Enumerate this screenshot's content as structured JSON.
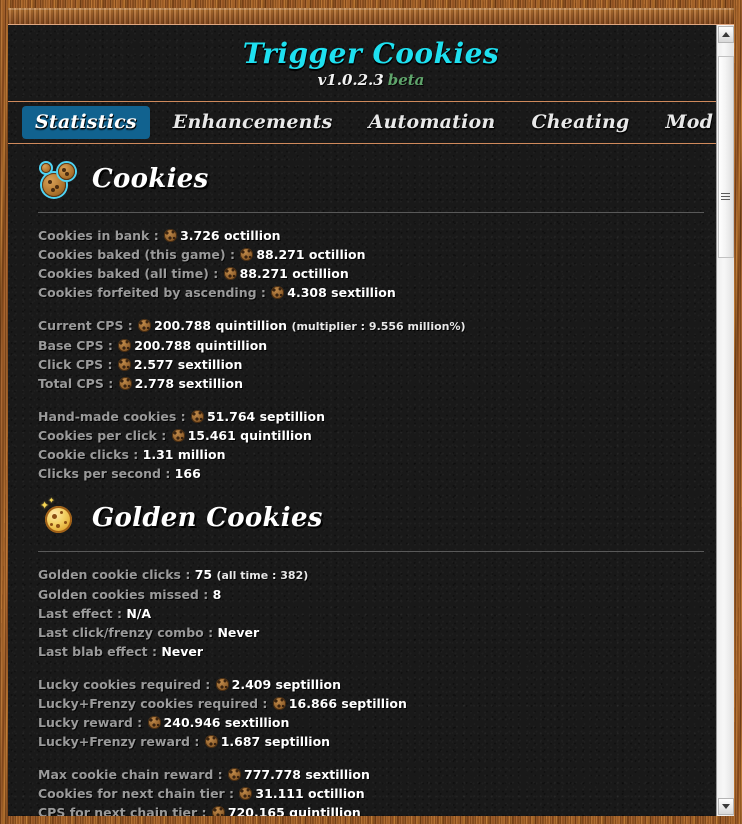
{
  "header": {
    "title": "Trigger Cookies",
    "version": "v1.0.2.3",
    "channel": "beta",
    "title_color": "#1ee0f0",
    "beta_color": "#5fa46b"
  },
  "tabs": [
    {
      "label": "Statistics",
      "active": true
    },
    {
      "label": "Enhancements",
      "active": false
    },
    {
      "label": "Automation",
      "active": false
    },
    {
      "label": "Cheating",
      "active": false
    },
    {
      "label": "Mod List",
      "active": false
    }
  ],
  "sections": [
    {
      "id": "cookies",
      "title": "Cookies",
      "icon": "cookie-stack-icon",
      "groups": [
        {
          "rows": [
            {
              "label": "Cookies in bank :",
              "cookie": true,
              "value": "3.726 octillion"
            },
            {
              "label": "Cookies baked (this game) :",
              "cookie": true,
              "value": "88.271 octillion"
            },
            {
              "label": "Cookies baked (all time) :",
              "cookie": true,
              "value": "88.271 octillion"
            },
            {
              "label": "Cookies forfeited by ascending :",
              "cookie": true,
              "value": "4.308 sextillion"
            }
          ]
        },
        {
          "rows": [
            {
              "label": "Current CPS :",
              "cookie": true,
              "value": "200.788 quintillion",
              "note": "(multiplier : 9.556 million%)"
            },
            {
              "label": "Base CPS :",
              "cookie": true,
              "value": "200.788 quintillion"
            },
            {
              "label": "Click CPS :",
              "cookie": true,
              "value": "2.577 sextillion"
            },
            {
              "label": "Total CPS :",
              "cookie": true,
              "value": "2.778 sextillion"
            }
          ]
        },
        {
          "rows": [
            {
              "label": "Hand-made cookies :",
              "cookie": true,
              "value": "51.764 septillion"
            },
            {
              "label": "Cookies per click :",
              "cookie": true,
              "value": "15.461 quintillion"
            },
            {
              "label": "Cookie clicks :",
              "cookie": false,
              "value": "1.31 million"
            },
            {
              "label": "Clicks per second :",
              "cookie": false,
              "value": "166"
            }
          ]
        }
      ]
    },
    {
      "id": "golden-cookies",
      "title": "Golden Cookies",
      "icon": "golden-cookie-icon",
      "groups": [
        {
          "rows": [
            {
              "label": "Golden cookie clicks :",
              "cookie": false,
              "value": "75",
              "note": "(all time : 382)"
            },
            {
              "label": "Golden cookies missed :",
              "cookie": false,
              "value": "8"
            },
            {
              "label": "Last effect :",
              "cookie": false,
              "value": "N/A"
            },
            {
              "label": "Last click/frenzy combo :",
              "cookie": false,
              "value": "Never"
            },
            {
              "label": "Last blab effect :",
              "cookie": false,
              "value": "Never"
            }
          ]
        },
        {
          "rows": [
            {
              "label": "Lucky cookies required :",
              "cookie": true,
              "value": "2.409 septillion"
            },
            {
              "label": "Lucky+Frenzy cookies required :",
              "cookie": true,
              "value": "16.866 septillion"
            },
            {
              "label": "Lucky reward :",
              "cookie": true,
              "value": "240.946 sextillion"
            },
            {
              "label": "Lucky+Frenzy reward :",
              "cookie": true,
              "value": "1.687 septillion"
            }
          ]
        },
        {
          "rows": [
            {
              "label": "Max cookie chain reward :",
              "cookie": true,
              "value": "777.778 sextillion"
            },
            {
              "label": "Cookies for next chain tier :",
              "cookie": true,
              "value": "31.111 octillion"
            },
            {
              "label": "CPS for next chain tier :",
              "cookie": true,
              "value": "720.165 quintillion"
            }
          ]
        }
      ]
    }
  ],
  "scrollbar": {
    "up_icon": "scroll-up-arrow-icon",
    "down_icon": "scroll-down-arrow-icon",
    "thumb": "scrollbar-thumb"
  }
}
